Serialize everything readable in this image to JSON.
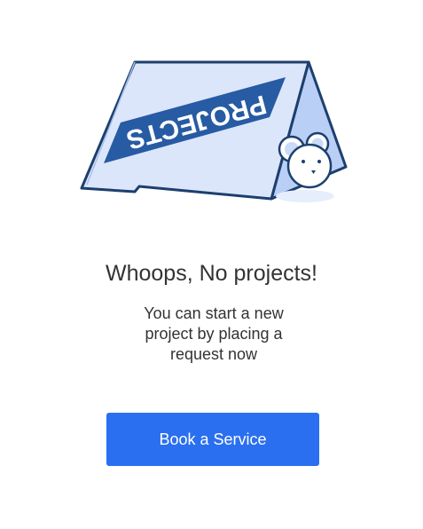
{
  "illustration": {
    "sign_text": "PROJECTS",
    "icon": "empty-projects-tent-sign-illustration",
    "colors": {
      "outline": "#1d3f6e",
      "face_fill": "#dce6fb",
      "side_fill": "#b9cff5",
      "banner_fill": "#275ba3",
      "banner_text": "#ffffff"
    }
  },
  "empty_state": {
    "title": "Whoops, No projects!",
    "message": "You can start a new project by placing a request now"
  },
  "actions": {
    "book_service_label": "Book a Service"
  },
  "colors": {
    "primary": "#2a6ff0",
    "text": "#333333",
    "background": "#ffffff"
  }
}
